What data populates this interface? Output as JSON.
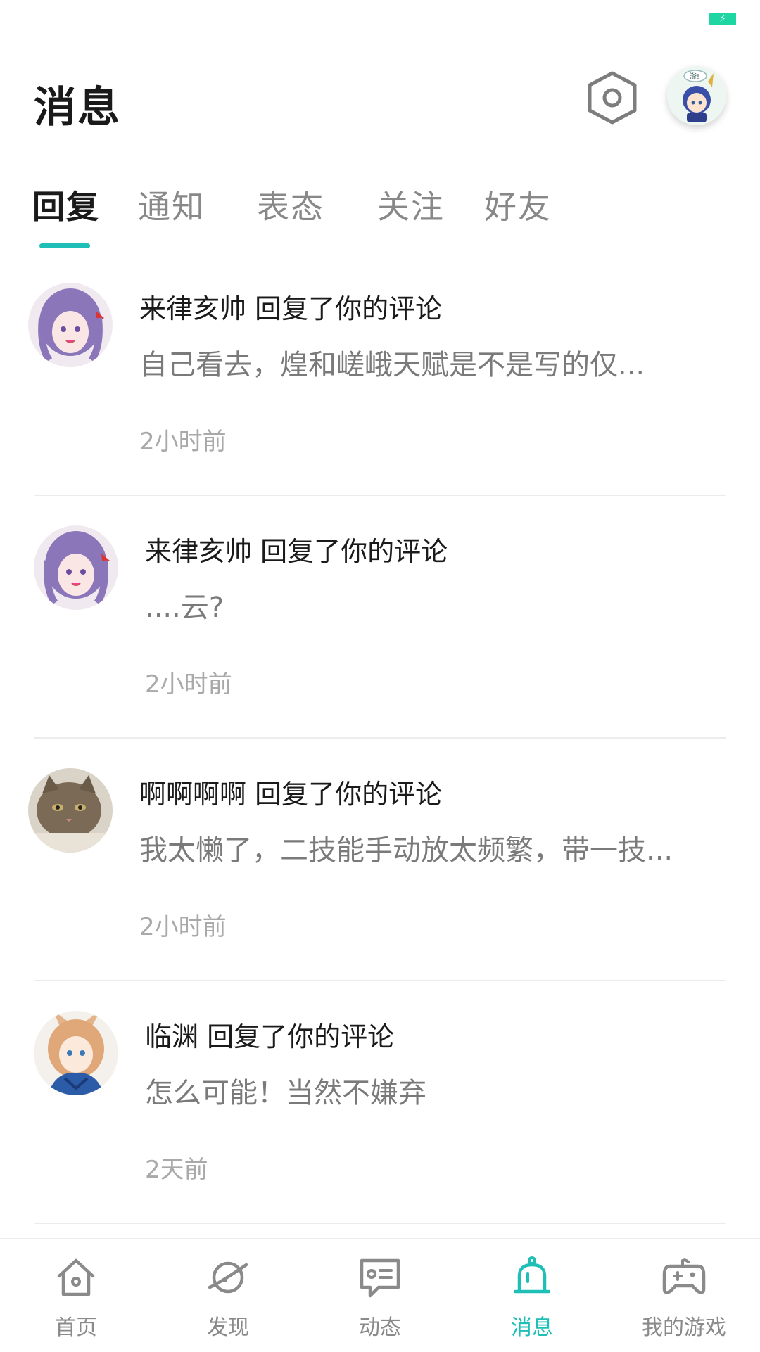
{
  "status_bar": {
    "battery_icon": "battery-charging-icon",
    "battery_color": "#1fd6a3"
  },
  "header": {
    "title": "消息",
    "settings_icon": "settings-hexagon-icon",
    "avatar_icon": "user-avatar",
    "avatar_badge": "滏!"
  },
  "tabs": [
    {
      "label": "回复",
      "active": true
    },
    {
      "label": "通知",
      "active": false
    },
    {
      "label": "表态",
      "active": false
    },
    {
      "label": "关注",
      "active": false
    },
    {
      "label": "好友",
      "active": false
    }
  ],
  "messages": [
    {
      "user": "来律亥帅",
      "action": "回复了你的评论",
      "title": "来律亥帅 回复了你的评论",
      "preview": "自己看去，煌和嵯峨天赋是不是写的仅...",
      "time": "2小时前"
    },
    {
      "user": "来律亥帅",
      "action": "回复了你的评论",
      "title": "来律亥帅 回复了你的评论",
      "preview": "....云?",
      "time": "2小时前"
    },
    {
      "user": "啊啊啊啊",
      "action": "回复了你的评论",
      "title": "啊啊啊啊 回复了你的评论",
      "preview": "我太懒了，二技能手动放太频繁，带一技...",
      "time": "2小时前"
    },
    {
      "user": "临渊",
      "action": "回复了你的评论",
      "title": "临渊 回复了你的评论",
      "preview": "怎么可能！当然不嫌弃",
      "time": "2天前"
    }
  ],
  "bottom_nav": [
    {
      "label": "首页",
      "icon": "home-icon",
      "active": false
    },
    {
      "label": "发现",
      "icon": "planet-icon",
      "active": false
    },
    {
      "label": "动态",
      "icon": "feed-chat-icon",
      "active": false
    },
    {
      "label": "消息",
      "icon": "bell-icon",
      "active": true
    },
    {
      "label": "我的游戏",
      "icon": "gamepad-icon",
      "active": false
    }
  ],
  "colors": {
    "accent": "#1fbfb8",
    "text_primary": "#1a1a1a",
    "text_secondary": "#7a7a7a",
    "text_muted": "#a9a9a9"
  }
}
